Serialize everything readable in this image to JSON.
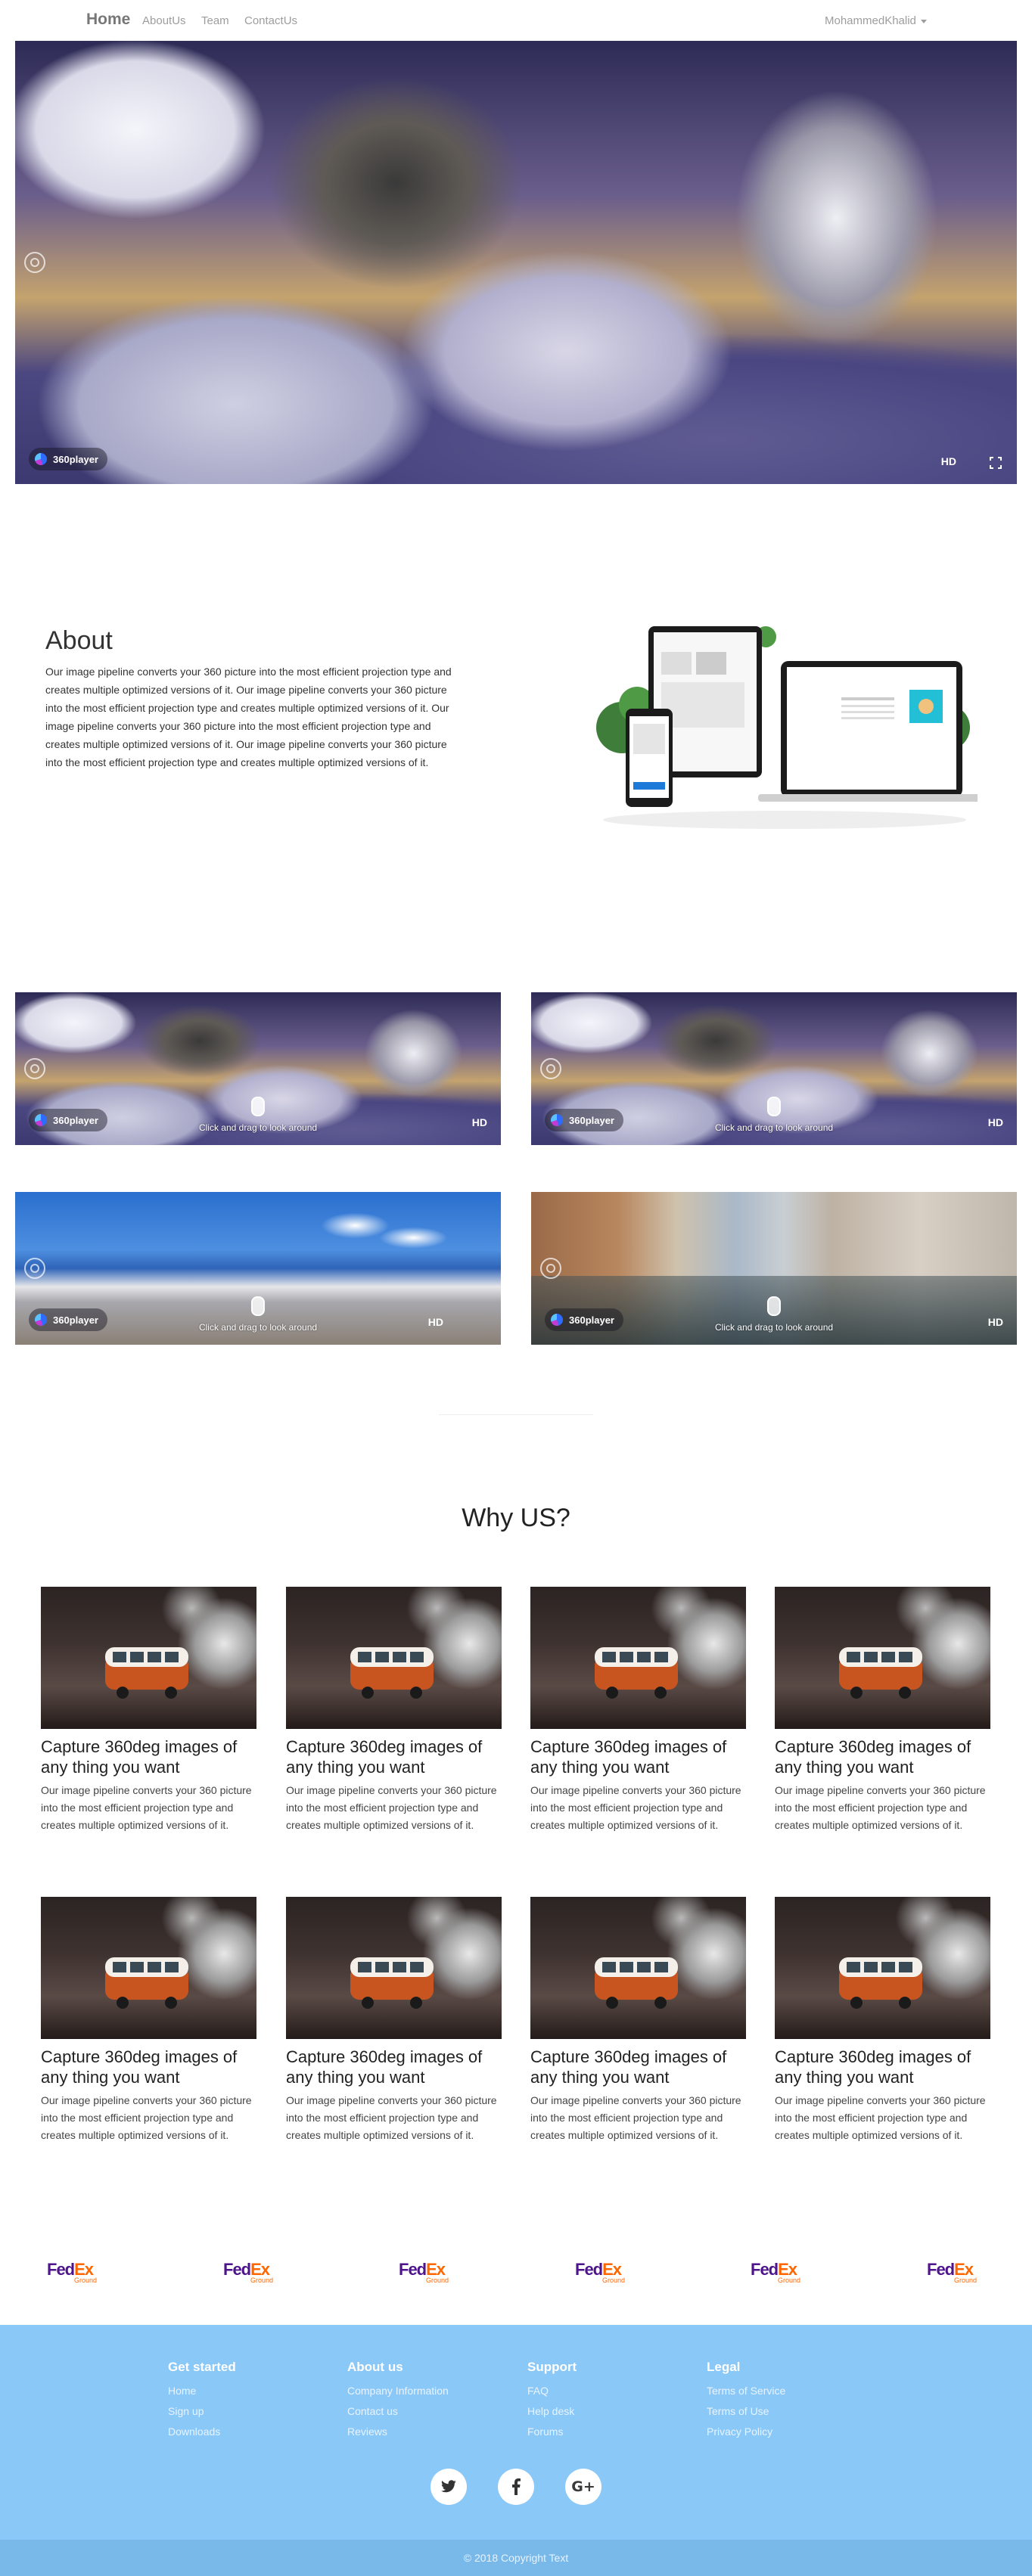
{
  "navbar": {
    "brand": "Home",
    "links": [
      "AboutUs",
      "Team",
      "ContactUs"
    ],
    "user": "MohammedKhalid"
  },
  "player": {
    "badge": "360player",
    "hd_label": "HD",
    "hint": "Click and drag to look around"
  },
  "about": {
    "title": "About",
    "text": "Our image pipeline converts your 360 picture into the most efficient projection type and creates multiple optimized versions of it. Our image pipeline converts your 360 picture into the most efficient projection type and creates multiple optimized versions of it. Our image pipeline converts your 360 picture into the most efficient projection type and creates multiple optimized versions of it. Our image pipeline converts your 360 picture into the most efficient projection type and creates multiple optimized versions of it."
  },
  "why": {
    "title": "Why US?",
    "cards": [
      {
        "title": "Capture 360deg images of any thing you want",
        "text": "Our image pipeline converts your 360 picture into the most efficient projection type and creates multiple optimized versions of it."
      },
      {
        "title": "Capture 360deg images of any thing you want",
        "text": "Our image pipeline converts your 360 picture into the most efficient projection type and creates multiple optimized versions of it."
      },
      {
        "title": "Capture 360deg images of any thing you want",
        "text": "Our image pipeline converts your 360 picture into the most efficient projection type and creates multiple optimized versions of it."
      },
      {
        "title": "Capture 360deg images of any thing you want",
        "text": "Our image pipeline converts your 360 picture into the most efficient projection type and creates multiple optimized versions of it."
      },
      {
        "title": "Capture 360deg images of any thing you want",
        "text": "Our image pipeline converts your 360 picture into the most efficient projection type and creates multiple optimized versions of it."
      },
      {
        "title": "Capture 360deg images of any thing you want",
        "text": "Our image pipeline converts your 360 picture into the most efficient projection type and creates multiple optimized versions of it."
      },
      {
        "title": "Capture 360deg images of any thing you want",
        "text": "Our image pipeline converts your 360 picture into the most efficient projection type and creates multiple optimized versions of it."
      },
      {
        "title": "Capture 360deg images of any thing you want",
        "text": "Our image pipeline converts your 360 picture into the most efficient projection type and creates multiple optimized versions of it."
      }
    ]
  },
  "partners": {
    "logo_fed": "Fed",
    "logo_ex": "Ex",
    "logo_sub": "Ground"
  },
  "footer": {
    "columns": [
      {
        "heading": "Get started",
        "links": [
          "Home",
          "Sign up",
          "Downloads"
        ]
      },
      {
        "heading": "About us",
        "links": [
          "Company Information",
          "Contact us",
          "Reviews"
        ]
      },
      {
        "heading": "Support",
        "links": [
          "FAQ",
          "Help desk",
          "Forums"
        ]
      },
      {
        "heading": "Legal",
        "links": [
          "Terms of Service",
          "Terms of Use",
          "Privacy Policy"
        ]
      }
    ],
    "social": [
      "twitter-icon",
      "facebook-icon",
      "google-plus-icon"
    ],
    "google_plus_label": "G+",
    "copyright": "© 2018 Copyright Text"
  },
  "colors": {
    "footer_bg": "#8ac8f8",
    "copyright_bg": "#79b9ea",
    "fedex_purple": "#4d148c",
    "fedex_orange": "#ff6600"
  }
}
